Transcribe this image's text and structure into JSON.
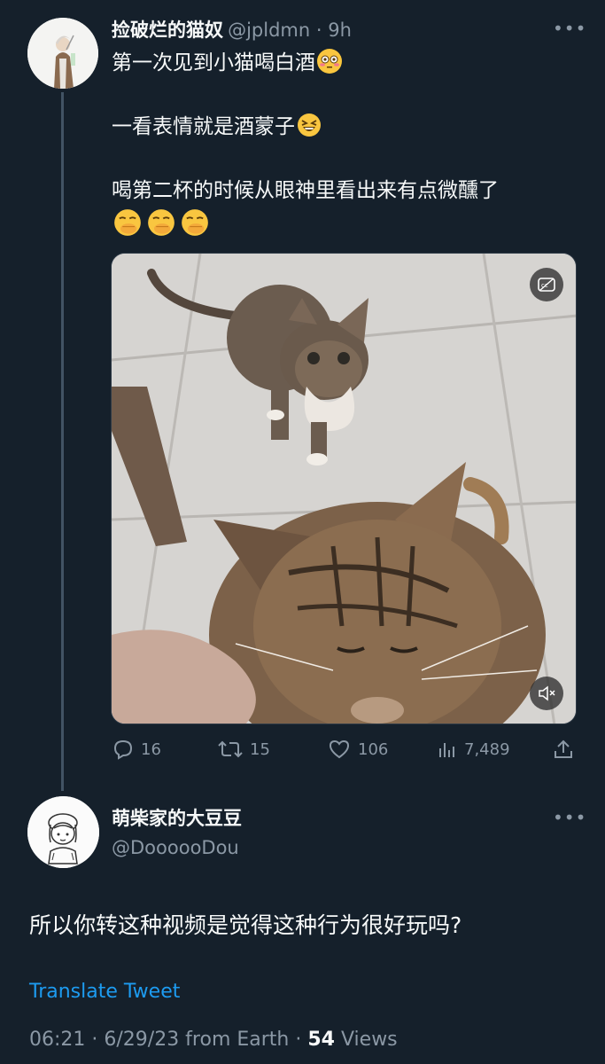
{
  "tweet1": {
    "name": "捡破烂的猫奴",
    "handle": "@jpldmn",
    "time": "9h",
    "line1": "第一次见到小猫喝白酒",
    "line2": "一看表情就是酒蒙子",
    "line3": "喝第二杯的时候从眼神里看出来有点微醺了",
    "emoji1": "flushed-face",
    "emoji2": "grinning-squinting-face",
    "emoji3": "face-with-hand-over-mouth",
    "media_cc_icon": "closed-captions-icon",
    "media_mute_icon": "muted-speaker-icon",
    "stats": {
      "replies": "16",
      "retweets": "15",
      "likes": "106",
      "views": "7,489"
    }
  },
  "tweet2": {
    "name": "萌柴家的大豆豆",
    "handle": "@DoooooDou",
    "text": "所以你转这种视频是觉得这种行为很好玩吗?",
    "translate": "Translate Tweet",
    "time": "06:21 · 6/29/23 from Earth · ",
    "views_count": "54",
    "views_label": " Views"
  },
  "colors": {
    "background": "#15202b",
    "text": "#f7f9f9",
    "muted": "#8b98a5",
    "link": "#1d9bf0"
  }
}
